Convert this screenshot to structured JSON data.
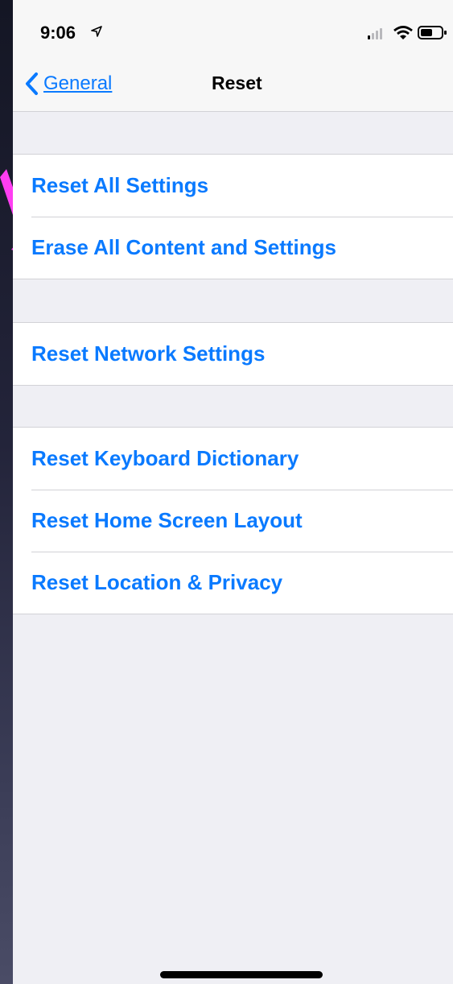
{
  "status": {
    "time": "9:06"
  },
  "nav": {
    "back_label": "General",
    "title": "Reset"
  },
  "groups": [
    {
      "items": [
        {
          "label": "Reset All Settings"
        },
        {
          "label": "Erase All Content and Settings"
        }
      ]
    },
    {
      "items": [
        {
          "label": "Reset Network Settings"
        }
      ]
    },
    {
      "items": [
        {
          "label": "Reset Keyboard Dictionary"
        },
        {
          "label": "Reset Home Screen Layout"
        },
        {
          "label": "Reset Location & Privacy"
        }
      ]
    }
  ],
  "colors": {
    "accent": "#0a7aff",
    "annotation_arrow": "#ff3ef2",
    "background": "#efeff4"
  }
}
